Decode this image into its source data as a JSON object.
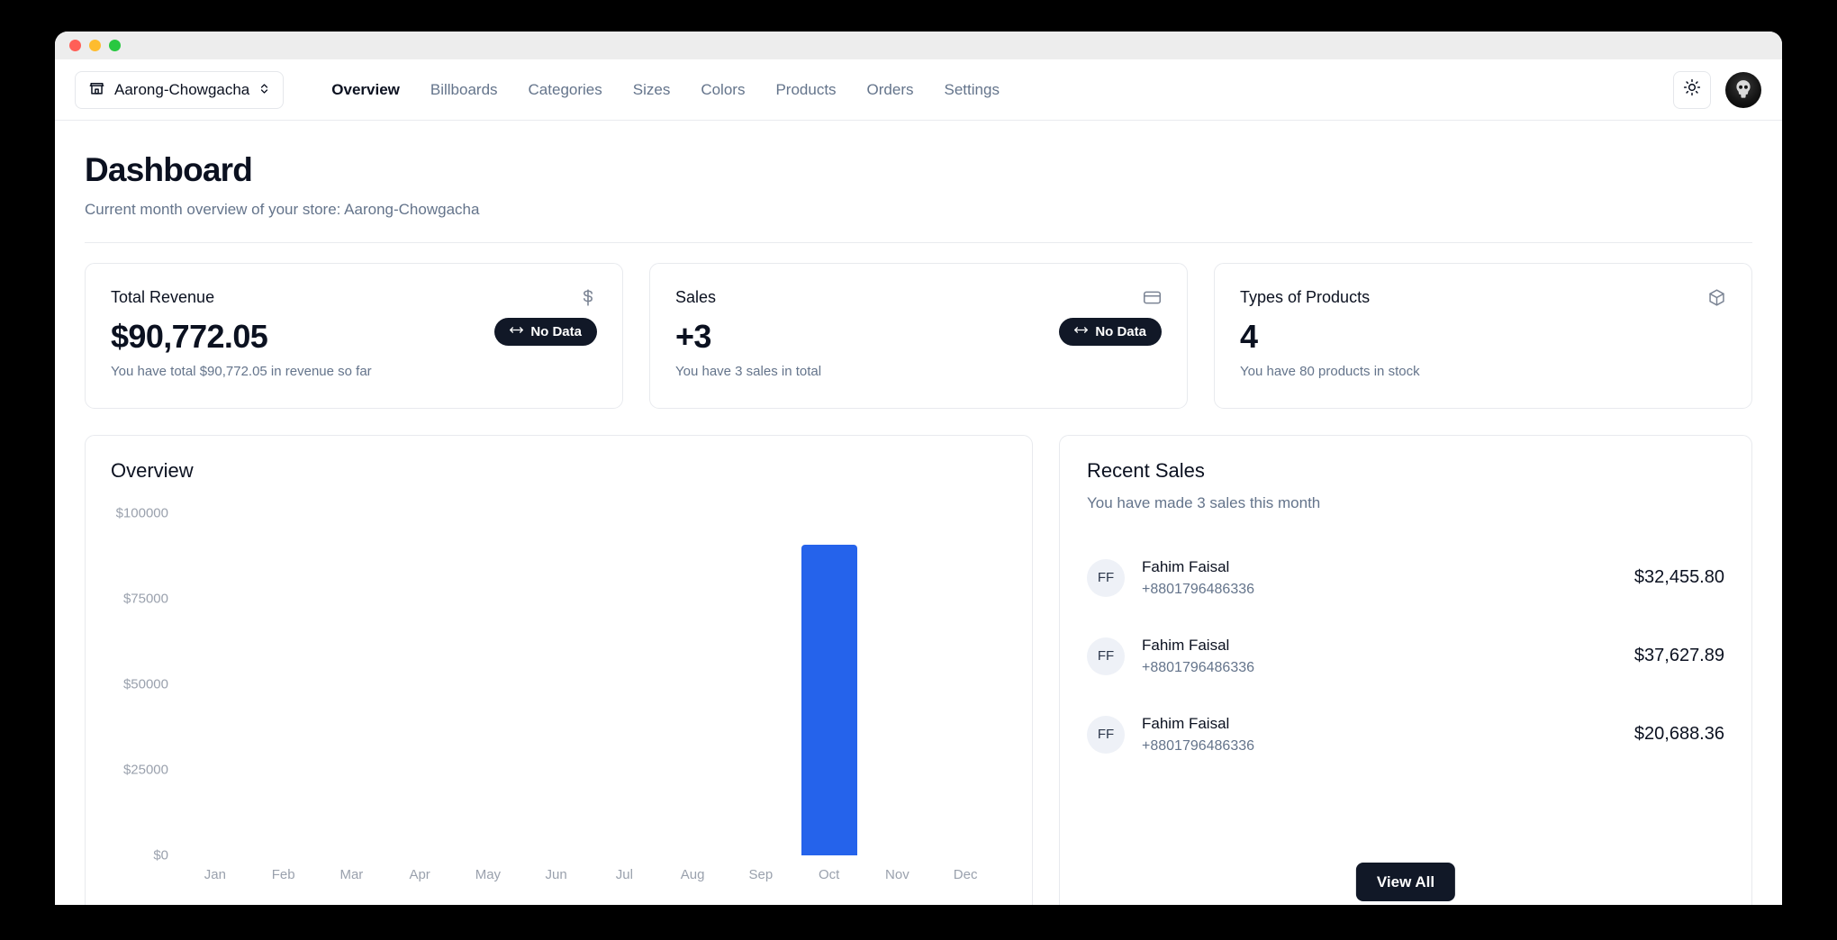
{
  "window": {
    "traffic_lights": [
      "close",
      "minimize",
      "maximize"
    ]
  },
  "nav": {
    "store_switcher": {
      "label": "Aarong-Chowgacha",
      "icon": "store-icon",
      "chevron": "⌃⌄"
    },
    "links": [
      {
        "label": "Overview",
        "active": true
      },
      {
        "label": "Billboards",
        "active": false
      },
      {
        "label": "Categories",
        "active": false
      },
      {
        "label": "Sizes",
        "active": false
      },
      {
        "label": "Colors",
        "active": false
      },
      {
        "label": "Products",
        "active": false
      },
      {
        "label": "Orders",
        "active": false
      },
      {
        "label": "Settings",
        "active": false
      }
    ],
    "theme_toggle_icon": "sun-icon",
    "avatar_icon": "user-avatar"
  },
  "header": {
    "title": "Dashboard",
    "subtitle": "Current month overview of your store: Aarong-Chowgacha"
  },
  "stats": [
    {
      "title": "Total Revenue",
      "icon": "dollar-icon",
      "value": "$90,772.05",
      "description": "You have total $90,772.05 in revenue so far",
      "badge": {
        "label": "No Data",
        "icon": "left-right-arrow-icon"
      }
    },
    {
      "title": "Sales",
      "icon": "credit-card-icon",
      "value": "+3",
      "description": "You have 3 sales in total",
      "badge": {
        "label": "No Data",
        "icon": "left-right-arrow-icon"
      }
    },
    {
      "title": "Types of Products",
      "icon": "package-icon",
      "value": "4",
      "description": "You have 80 products in stock",
      "badge": null
    }
  ],
  "overview": {
    "heading": "Overview"
  },
  "chart_data": {
    "type": "bar",
    "title": "Overview",
    "xlabel": "",
    "ylabel": "",
    "categories": [
      "Jan",
      "Feb",
      "Mar",
      "Apr",
      "May",
      "Jun",
      "Jul",
      "Aug",
      "Sep",
      "Oct",
      "Nov",
      "Dec"
    ],
    "values": [
      0,
      0,
      0,
      0,
      0,
      0,
      0,
      0,
      0,
      90772.05,
      0,
      0
    ],
    "ylim": [
      0,
      100000
    ],
    "yticks": [
      0,
      25000,
      50000,
      75000,
      100000
    ],
    "ytick_labels": [
      "$0",
      "$25000",
      "$50000",
      "$75000",
      "$100000"
    ],
    "grid": false,
    "legend": false,
    "bar_color": "#2563eb"
  },
  "recent_sales": {
    "heading": "Recent Sales",
    "subtitle": "You have made 3 sales this month",
    "rows": [
      {
        "initials": "FF",
        "name": "Fahim Faisal",
        "phone": "+8801796486336",
        "amount": "$32,455.80"
      },
      {
        "initials": "FF",
        "name": "Fahim Faisal",
        "phone": "+8801796486336",
        "amount": "$37,627.89"
      },
      {
        "initials": "FF",
        "name": "Fahim Faisal",
        "phone": "+8801796486336",
        "amount": "$20,688.36"
      }
    ],
    "view_all_label": "View All"
  },
  "colors": {
    "accent_bar": "#2563eb",
    "badge_bg": "#111827",
    "button_bg": "#111827",
    "text_primary": "#0b1120",
    "text_muted": "#64748b",
    "axis_text": "#9aa1ad"
  }
}
